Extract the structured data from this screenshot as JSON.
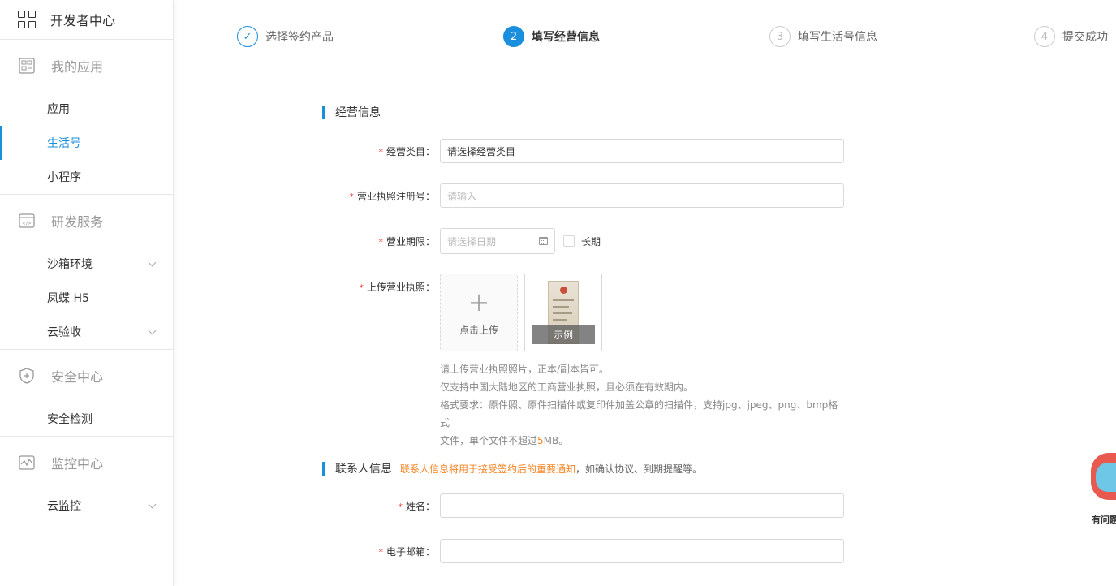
{
  "sidebar": {
    "title": "开发者中心",
    "groups": [
      {
        "title": "我的应用",
        "icon": "apps-icon",
        "items": [
          {
            "label": "应用"
          },
          {
            "label": "生活号",
            "active": true
          },
          {
            "label": "小程序"
          }
        ]
      },
      {
        "title": "研发服务",
        "icon": "code-window-icon",
        "items": [
          {
            "label": "沙箱环境",
            "expandable": true
          },
          {
            "label": "凤蝶 H5"
          },
          {
            "label": "云验收",
            "expandable": true
          }
        ]
      },
      {
        "title": "安全中心",
        "icon": "shield-plus-icon",
        "items": [
          {
            "label": "安全检测"
          }
        ]
      },
      {
        "title": "监控中心",
        "icon": "monitor-chart-icon",
        "items": [
          {
            "label": "云监控",
            "expandable": true
          }
        ]
      }
    ]
  },
  "steps": [
    {
      "num": "✓",
      "label": "选择签约产品",
      "state": "done"
    },
    {
      "num": "2",
      "label": "填写经营信息",
      "state": "current"
    },
    {
      "num": "3",
      "label": "填写生活号信息",
      "state": "pending"
    },
    {
      "num": "4",
      "label": "提交成功",
      "state": "pending"
    }
  ],
  "business": {
    "title": "经营信息",
    "category": {
      "label": "经营类目：",
      "value": "请选择经营类目"
    },
    "license_no": {
      "label": "营业执照注册号：",
      "placeholder": "请输入"
    },
    "period": {
      "label": "营业期限：",
      "placeholder": "请选择日期",
      "long_term": "长期"
    },
    "upload": {
      "label": "上传营业执照：",
      "button": "点击上传",
      "example": "示例"
    },
    "tips": {
      "line1": "请上传营业执照照片，正本/副本皆可。",
      "line2": "仅支持中国大陆地区的工商营业执照，且必须在有效期内。",
      "line3": "格式要求：原件照、原件扫描件或复印件加盖公章的扫描件，支持jpg、jpeg、png、bmp格式",
      "line4_pre": "文件，单个文件不超过",
      "line4_size": "5",
      "line4_post": "MB。"
    }
  },
  "contact": {
    "title": "联系人信息",
    "note_highlight": "联系人信息将用于接受签约后的重要通知",
    "note_rest": "，如确认协议、到期提醒等。",
    "name": {
      "label": "姓名："
    },
    "email": {
      "label": "电子邮箱："
    }
  },
  "helper": {
    "text": "有问题"
  },
  "colors": {
    "accent": "#1a8fdd",
    "required": "#f04134",
    "highlight": "#f5821f"
  }
}
